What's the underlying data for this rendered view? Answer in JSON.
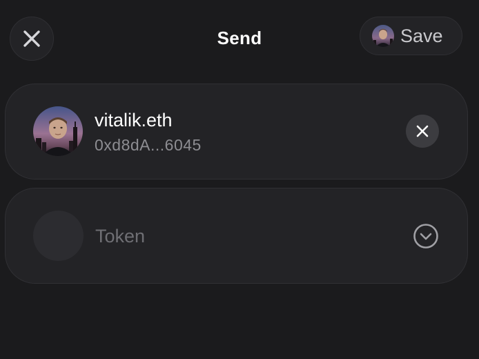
{
  "header": {
    "title": "Send",
    "save_label": "Save",
    "close_icon": "close-icon"
  },
  "recipient": {
    "name": "vitalik.eth",
    "address": "0xd8dA...6045",
    "clear_icon": "close-icon"
  },
  "token": {
    "placeholder": "Token",
    "dropdown_icon": "chevron-down-circle-icon"
  },
  "colors": {
    "background": "#1b1b1d",
    "card": "#232326",
    "muted_text": "#8d8d92"
  }
}
